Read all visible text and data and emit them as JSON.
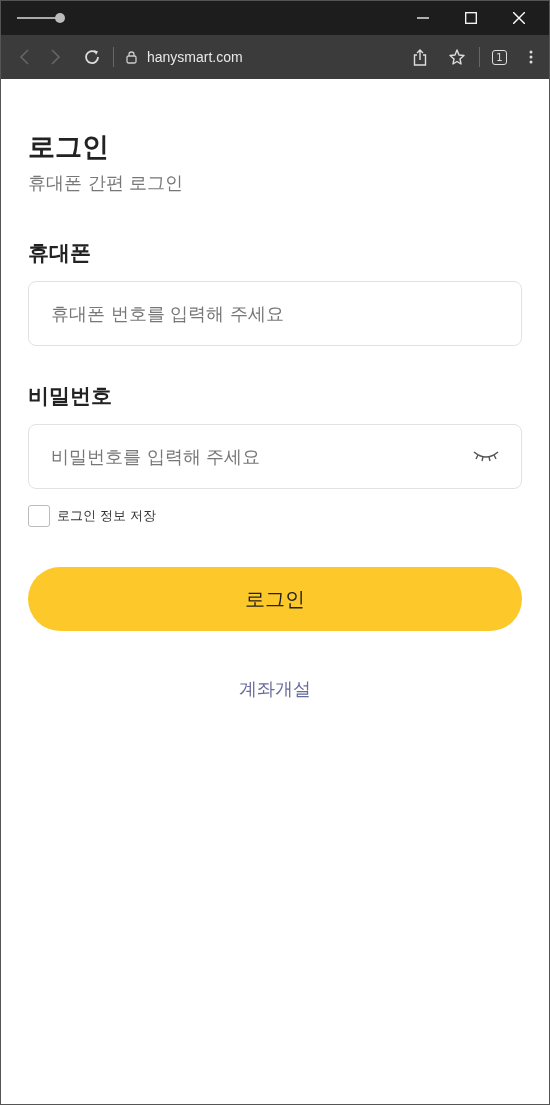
{
  "browser": {
    "address": "hanysmart.com",
    "tab_count": "1",
    "back_disabled": true,
    "forward_disabled": true
  },
  "page": {
    "title": "로그인",
    "subtitle": "휴대폰 간편 로그인",
    "fields": [
      {
        "label": "휴대폰",
        "placeholder": "휴대폰 번호를 입력해 주세요",
        "kind": "text"
      },
      {
        "label": "비밀번호",
        "placeholder": "비밀번호를 입력해 주세요",
        "kind": "password"
      }
    ],
    "remember": {
      "label": "로그인 정보 저장",
      "checked": false
    },
    "login_button": "로그인",
    "signup_link": "계좌개설"
  }
}
